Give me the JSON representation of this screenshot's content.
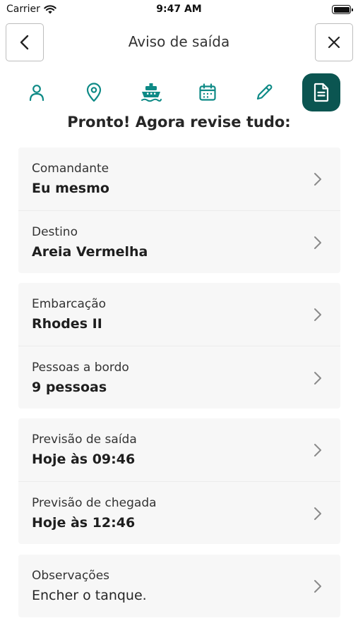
{
  "status_bar": {
    "carrier": "Carrier",
    "time": "9:47 AM"
  },
  "header": {
    "title": "Aviso de saída"
  },
  "steps": [
    {
      "icon": "person-icon",
      "active": false
    },
    {
      "icon": "location-pin-icon",
      "active": false
    },
    {
      "icon": "boat-icon",
      "active": false
    },
    {
      "icon": "calendar-icon",
      "active": false
    },
    {
      "icon": "pencil-icon",
      "active": false
    },
    {
      "icon": "document-icon",
      "active": true
    }
  ],
  "heading": "Pronto! Agora revise tudo:",
  "sections": [
    {
      "rows": [
        {
          "label": "Comandante",
          "value": "Eu mesmo"
        },
        {
          "label": "Destino",
          "value": "Areia Vermelha"
        }
      ]
    },
    {
      "rows": [
        {
          "label": "Embarcação",
          "value": "Rhodes II"
        },
        {
          "label": "Pessoas a bordo",
          "value": "9 pessoas"
        }
      ]
    },
    {
      "rows": [
        {
          "label": "Previsão de saída",
          "value": "Hoje às 09:46"
        },
        {
          "label": "Previsão de chegada",
          "value": "Hoje às 12:46"
        }
      ]
    },
    {
      "rows": [
        {
          "label": "Observações",
          "value": "Encher o tanque."
        }
      ]
    }
  ],
  "colors": {
    "accent": "#0b5551",
    "icon_teal": "#0e8a86",
    "card_bg": "#f7f7f7"
  }
}
